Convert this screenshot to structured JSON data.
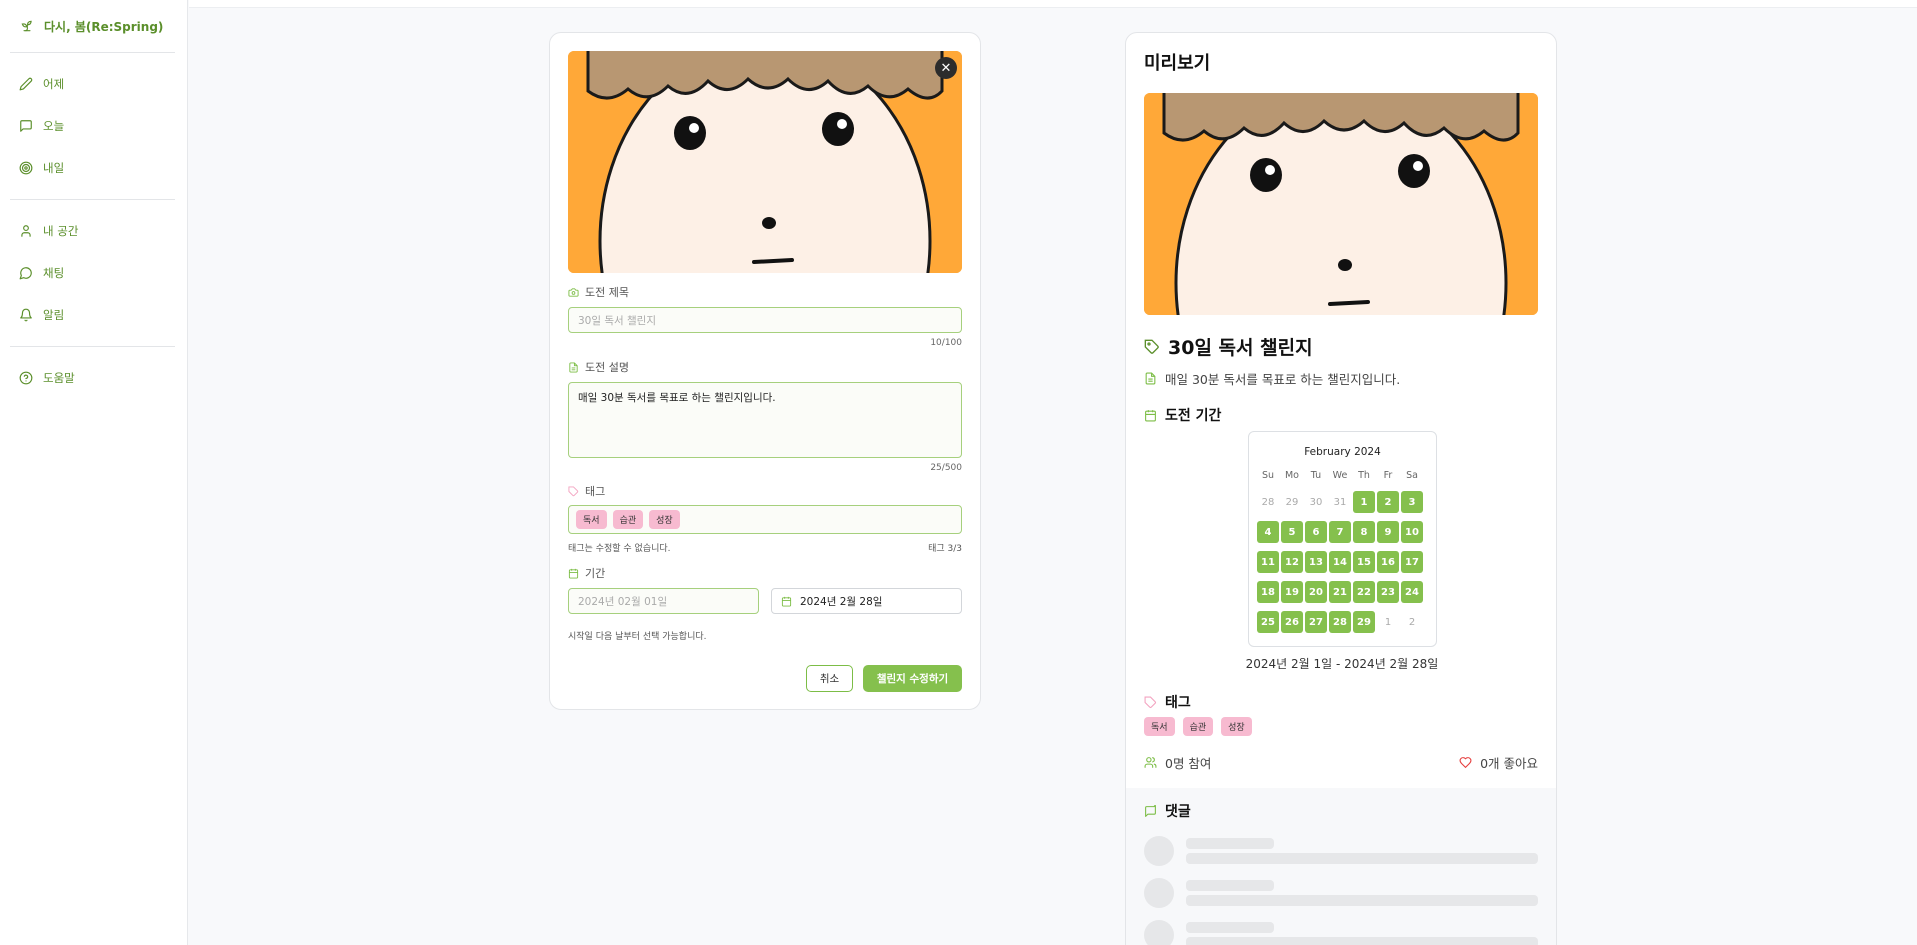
{
  "app": {
    "brand": "다시, 봄(Re:Spring)"
  },
  "sidebar": {
    "group1": [
      {
        "label": "어제",
        "icon": "pencil-icon"
      },
      {
        "label": "오늘",
        "icon": "message-square-icon"
      },
      {
        "label": "내일",
        "icon": "target-icon"
      }
    ],
    "group2": [
      {
        "label": "내 공간",
        "icon": "user-icon"
      },
      {
        "label": "채팅",
        "icon": "message-circle-icon"
      },
      {
        "label": "알림",
        "icon": "bell-icon"
      }
    ],
    "group3": [
      {
        "label": "도움말",
        "icon": "help-circle-icon"
      }
    ]
  },
  "form": {
    "title_label": "도전 제목",
    "title_placeholder": "30일 독서 챌린지",
    "title_counter": "10/100",
    "desc_label": "도전 설명",
    "desc_value": "매일 30분 독서를 목표로 하는 챌린지입니다.",
    "desc_counter": "25/500",
    "tags_label": "태그",
    "tags": [
      "독서",
      "습관",
      "성장"
    ],
    "tags_hint": "태그는 수정할 수 없습니다.",
    "tags_counter": "태그 3/3",
    "period_label": "기간",
    "start_placeholder": "2024년 02월 01일",
    "end_value": "2024년 2월 28일",
    "period_hint": "시작일 다음 날부터 선택 가능합니다.",
    "cancel_label": "취소",
    "submit_label": "챌린지 수정하기"
  },
  "preview": {
    "heading": "미리보기",
    "title": "30일 독서 챌린지",
    "description": "매일 30분 독서를 목표로 하는 챌린지입니다.",
    "period_heading": "도전 기간",
    "calendar": {
      "month": "February 2024",
      "weekdays": [
        "Su",
        "Mo",
        "Tu",
        "We",
        "Th",
        "Fr",
        "Sa"
      ],
      "weeks": [
        [
          "28",
          "29",
          "30",
          "31",
          "1",
          "2",
          "3"
        ],
        [
          "4",
          "5",
          "6",
          "7",
          "8",
          "9",
          "10"
        ],
        [
          "11",
          "12",
          "13",
          "14",
          "15",
          "16",
          "17"
        ],
        [
          "18",
          "19",
          "20",
          "21",
          "22",
          "23",
          "24"
        ],
        [
          "25",
          "26",
          "27",
          "28",
          "29",
          "1",
          "2"
        ]
      ],
      "selected_range": [
        "2024-02-01",
        "2024-02-28"
      ]
    },
    "period_text": "2024년 2월 1일 - 2024년 2월 28일",
    "tags_heading": "태그",
    "tags": [
      "독서",
      "습관",
      "성장"
    ],
    "participants": "0명 참여",
    "likes": "0개 좋아요",
    "comments_heading": "댓글"
  },
  "colors": {
    "accent": "#85c04d",
    "accent_text": "#5b8f2b",
    "tag": "#f7bad0",
    "like": "#e53e3e",
    "art_bg": "#ffa838"
  }
}
